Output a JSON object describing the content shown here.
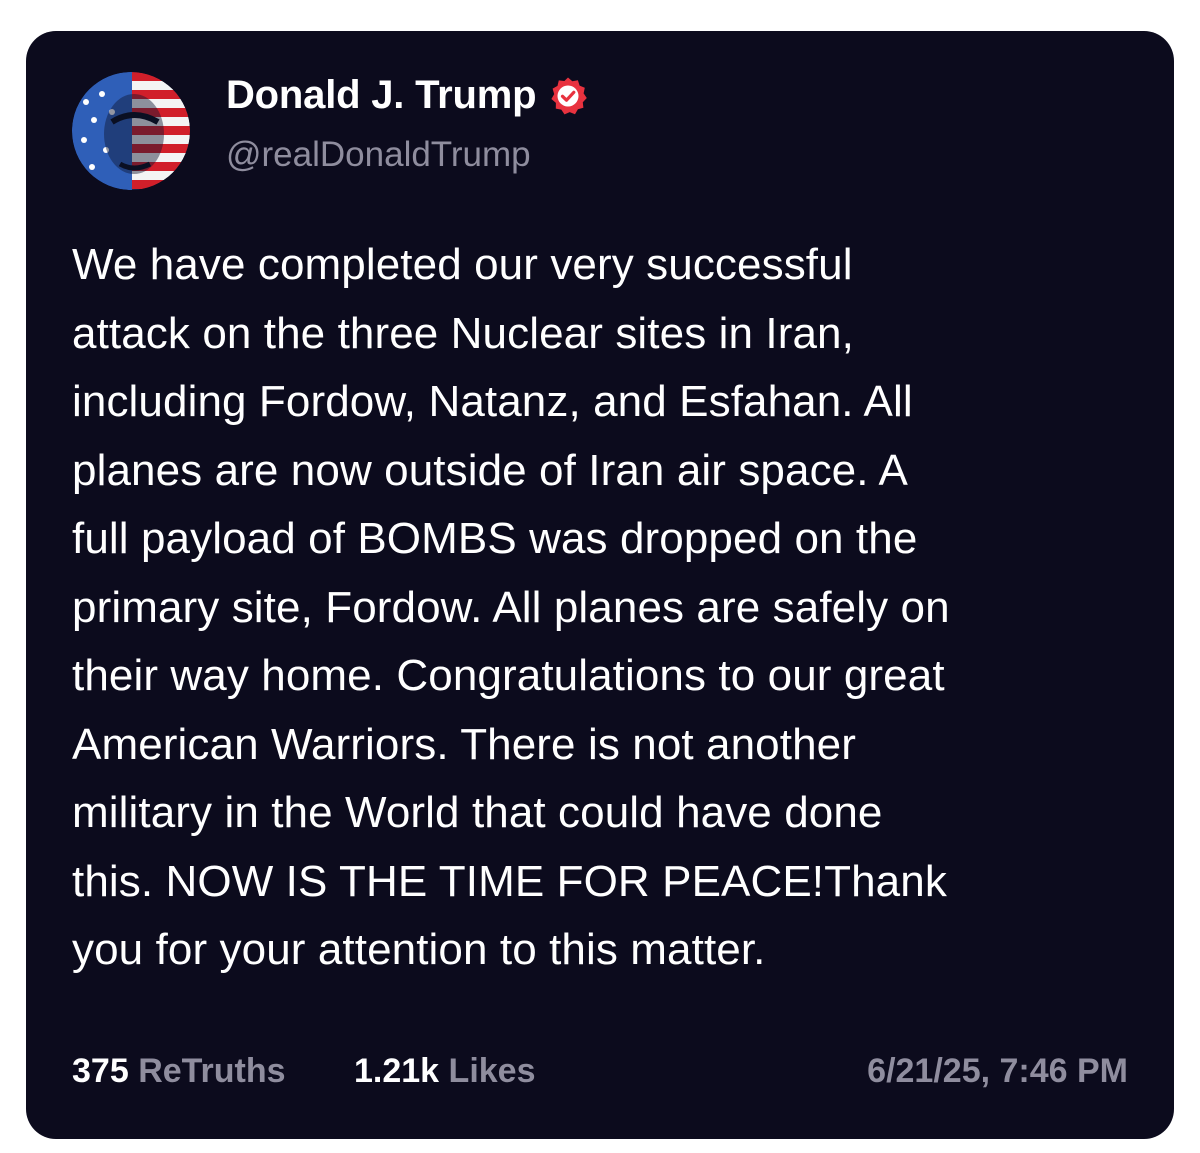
{
  "post": {
    "author_name": "Donald J. Trump",
    "author_handle": "@realDonaldTrump",
    "verified_icon": "verified-badge-icon",
    "avatar_icon": "profile-avatar",
    "text_lines": [
      "We have completed our very successful",
      "attack on the three Nuclear sites in Iran,",
      "including Fordow, Natanz, and Esfahan. All",
      "planes are now outside of Iran air space. A",
      "full payload of BOMBS was dropped on the",
      "primary site, Fordow. All planes are safely on",
      "their way home. Congratulations to our great",
      "American Warriors. There is not another",
      "military in the World that could have done",
      "this. NOW IS THE TIME FOR PEACE!Thank",
      "you for your attention to this matter."
    ],
    "retruths_count": "375",
    "retruths_label": "ReTruths",
    "likes_count": "1.21k",
    "likes_label": "Likes",
    "timestamp": "6/21/25, 7:46 PM"
  },
  "colors": {
    "card_background": "#0c0b1d",
    "text_primary": "#ffffff",
    "text_secondary": "#8f8d9e",
    "verified_badge": "#e8323f"
  }
}
